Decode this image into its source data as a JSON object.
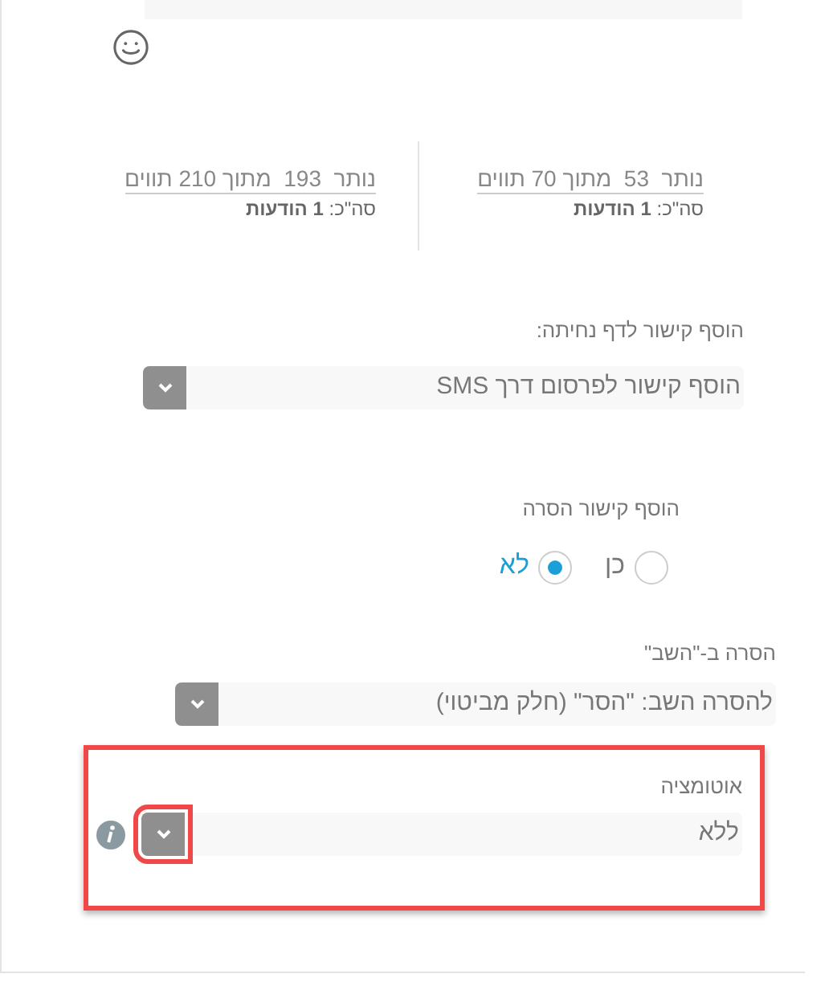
{
  "counters": [
    {
      "remaining_text": "נותר  53  מתוך 70 תווים",
      "total_text": "סה\"כ: **1 הודעות**"
    },
    {
      "remaining_text": "נותר  193  מתוך 210 תווים",
      "total_text": "סה\"כ: **1 הודעות**"
    }
  ],
  "landing_link": {
    "label": "הוסף קישור לדף נחיתה:",
    "value": "הוסף קישור לפרסום דרך SMS"
  },
  "removal_link": {
    "label": "הוסף קישור הסרה",
    "options": [
      {
        "label": "כן",
        "selected": false
      },
      {
        "label": "לא",
        "selected": true
      }
    ]
  },
  "reply_removal": {
    "label": "הסרה ב-\"השב\"",
    "value": "להסרה השב: \"הסר\" (חלק מביטוי)"
  },
  "automation": {
    "label": "אוטומציה",
    "value": "ללא",
    "highlighted": true,
    "arrow_highlighted": true
  }
}
